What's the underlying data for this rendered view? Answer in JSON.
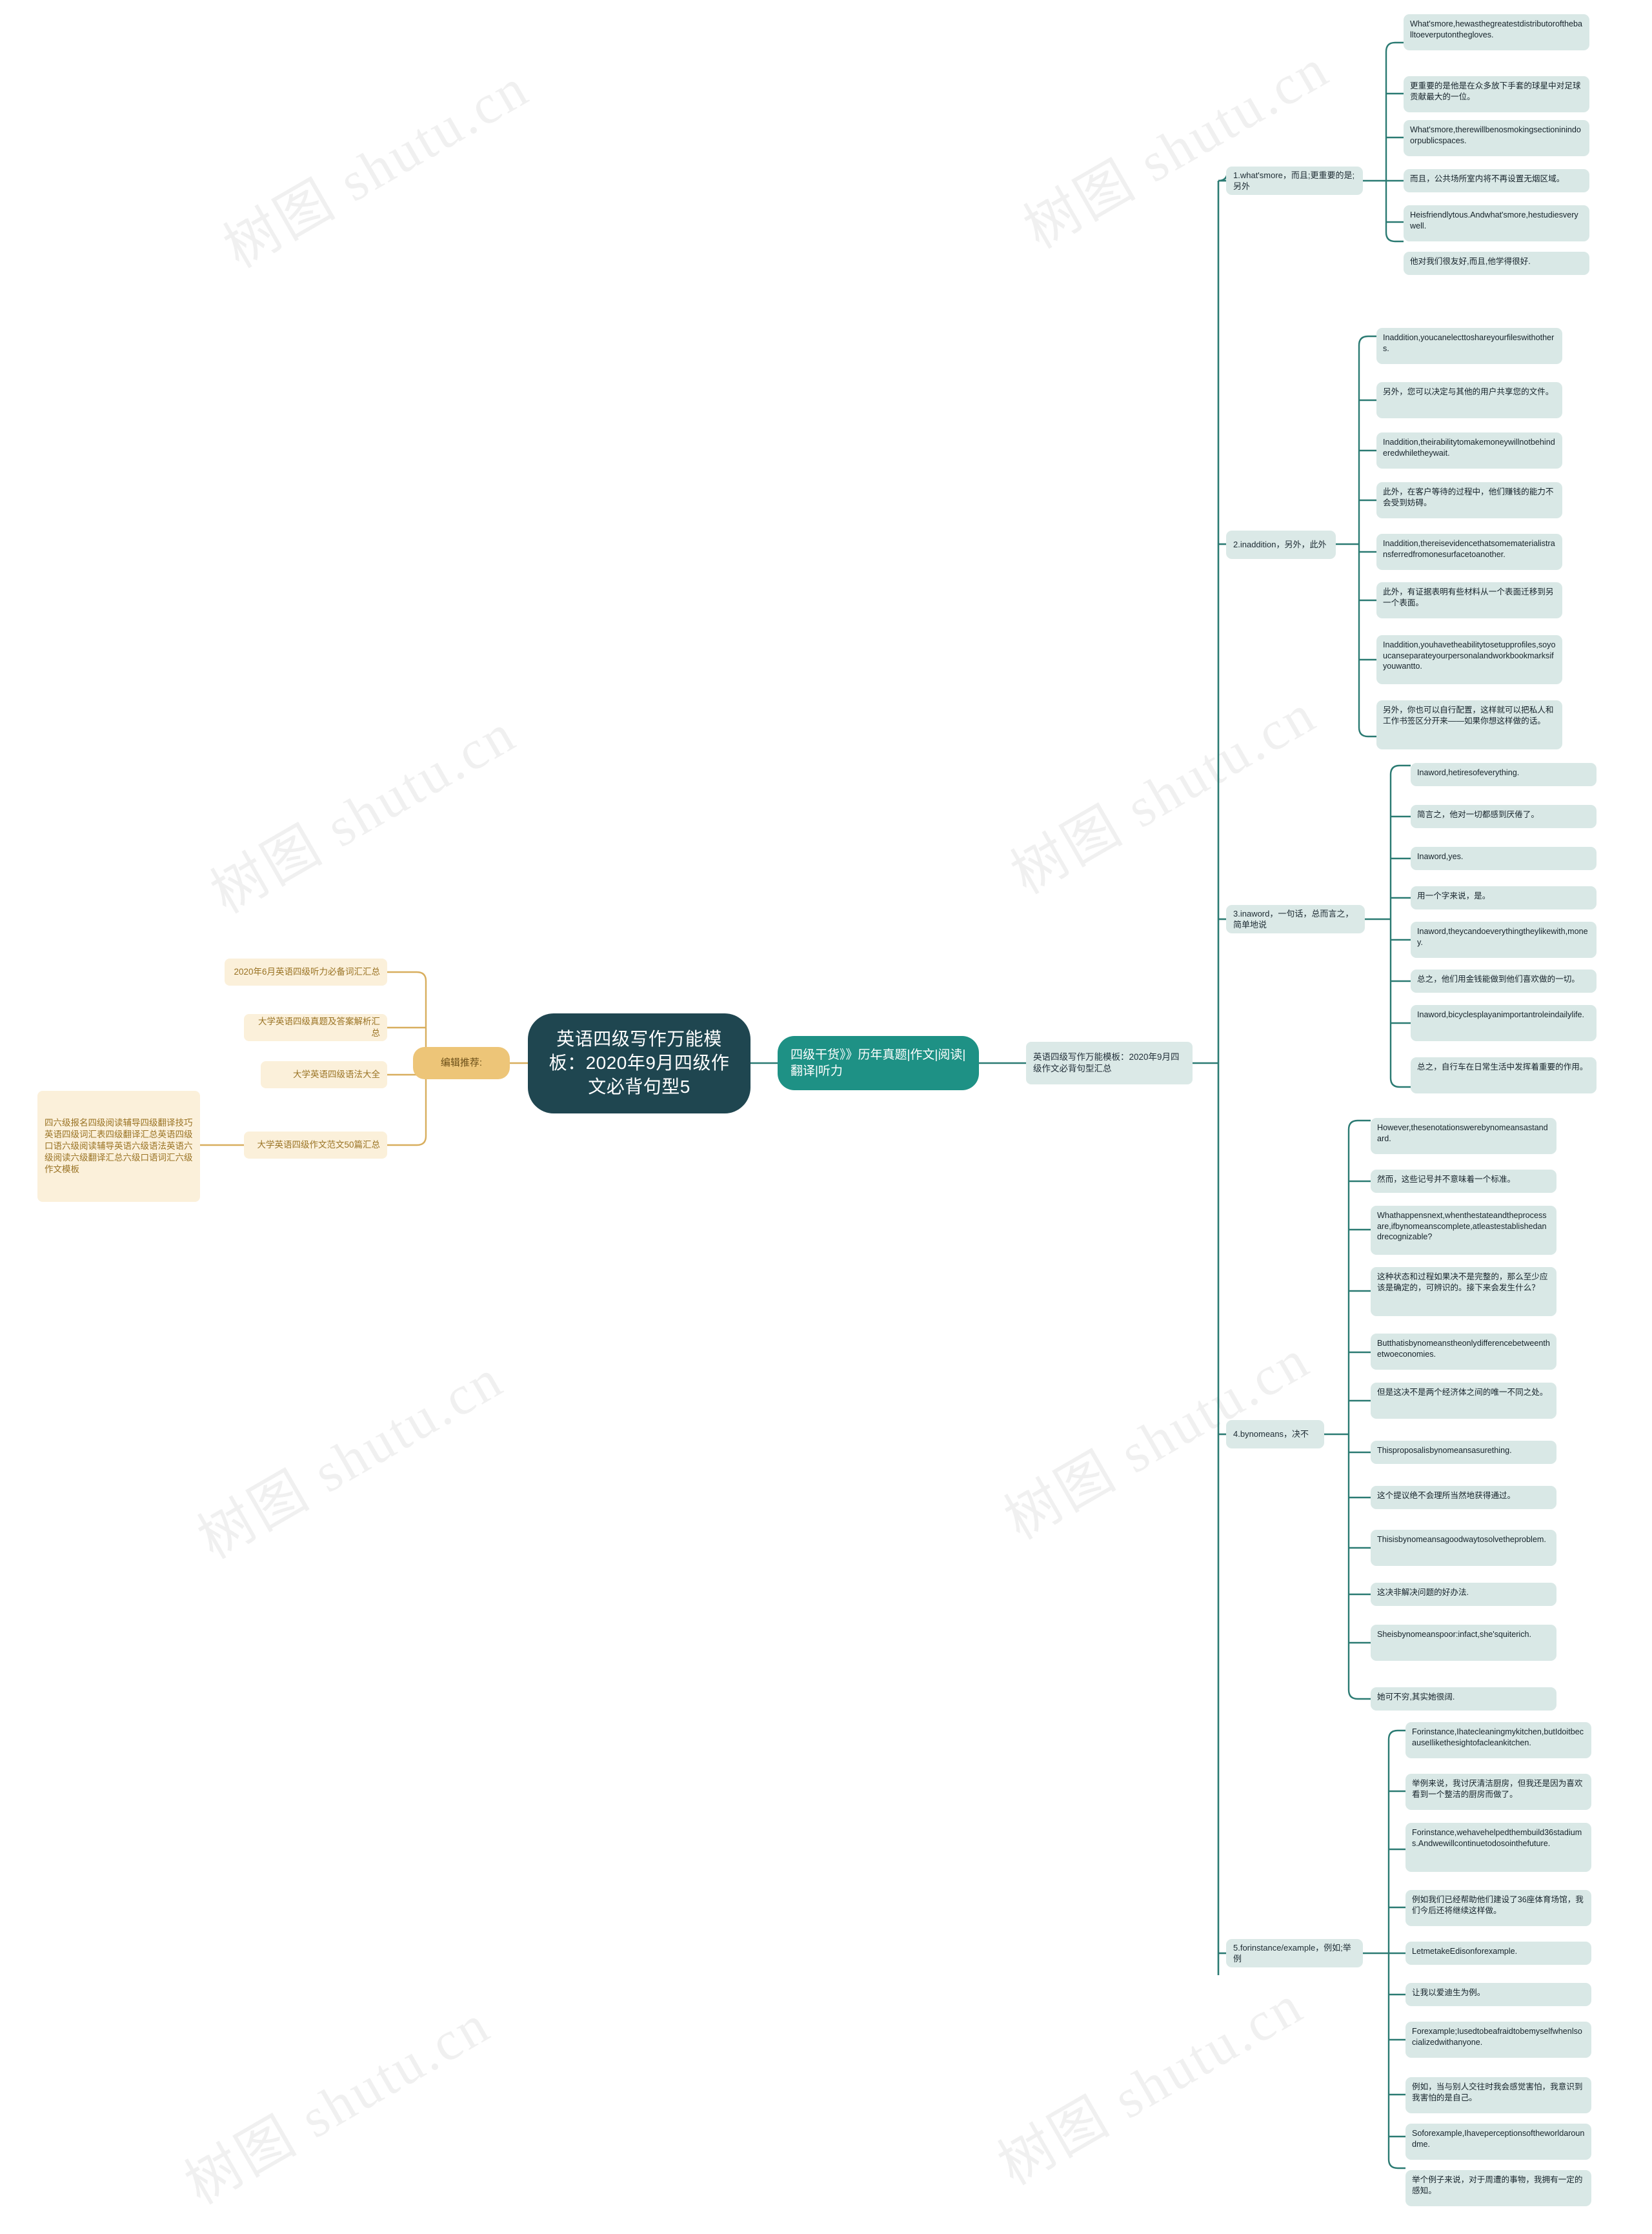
{
  "watermark": {
    "text": "树图 shutu.cn"
  },
  "colors": {
    "root_bg": "#1f4650",
    "level1_green": "#1e9185",
    "level1_gold": "#edc578",
    "leaf_bg": "#d9e8e6",
    "gold_leaf_bg": "#fbf0da",
    "link_green": "#2a7a72",
    "link_gold": "#d8ae5e"
  },
  "root": {
    "label": "英语四级写作万能模板：2020年9月四级作文必背句型5"
  },
  "left": {
    "level1": {
      "label": "编辑推荐:"
    },
    "items": [
      {
        "label": "2020年6月英语四级听力必备词汇汇总"
      },
      {
        "label": "大学英语四级真题及答案解析汇总"
      },
      {
        "label": "大学英语四级语法大全"
      },
      {
        "label": "大学英语四级作文范文50篇汇总"
      }
    ],
    "tail": {
      "label": "四六级报名四级阅读辅导四级翻译技巧英语四级词汇表四级翻译汇总英语四级口语六级阅读辅导英语六级语法英语六级阅读六级翻译汇总六级口语词汇六级作文模板"
    }
  },
  "right": {
    "level1": {
      "label": "四级干货》》历年真题|作文|阅读|翻译|听力"
    },
    "topic": {
      "label": "英语四级写作万能模板：2020年9月四级作文必背句型汇总"
    },
    "branches": [
      {
        "label": "1.what'smore，而且;更重要的是;另外",
        "leaves": [
          "What'smore,hewasthegreatestdistributoroftheballtoeverputonthegloves.",
          "更重要的是他是在众多放下手套的球星中对足球贡献最大的一位。",
          "What'smore,therewillbenosmokingsectioninindoorpublicspaces.",
          "而且，公共场所室内将不再设置无烟区域。",
          "Heisfriendlytous.Andwhat'smore,hestudiesverywell.",
          "他对我们很友好,而且,他学得很好."
        ]
      },
      {
        "label": "2.inaddition，另外，此外",
        "leaves": [
          "Inaddition,youcanelecttoshareyourfileswithothers.",
          "另外，您可以决定与其他的用户共享您的文件。",
          "Inaddition,theirabilitytomakemoneywillnotbehinderedwhiletheywait.",
          "此外，在客户等待的过程中，他们赚钱的能力不会受到妨碍。",
          "Inaddition,thereisevidencethatsomematerialistransferredfromonesurfacetoanother.",
          "此外，有证据表明有些材料从一个表面迁移到另一个表面。",
          "Inaddition,youhavetheabilitytosetupprofiles,soyoucanseparateyourpersonalandworkbookmarksifyouwantto.",
          "另外，你也可以自行配置，这样就可以把私人和工作书签区分开来——如果你想这样做的话。"
        ]
      },
      {
        "label": "3.inaword，一句话，总而言之，简单地说",
        "leaves": [
          "Inaword,hetiresofeverything.",
          "简言之，他对一切都感到厌倦了。",
          "Inaword,yes.",
          "用一个字来说，是。",
          "Inaword,theycandoeverythingtheylikewith,money.",
          "总之，他们用金钱能做到他们喜欢做的一切。",
          "Inaword,bicyclesplayanimportantroleindailylife.",
          "总之，自行车在日常生活中发挥着重要的作用。"
        ]
      },
      {
        "label": "4.bynomeans，决不",
        "leaves": [
          "However,thesenotationswerebynomeansastandard.",
          "然而，这些记号并不意味着一个标准。",
          "Whathappensnext,whenthestateandtheprocessare,ifbynomeanscomplete,atleastestablishedandrecognizable?",
          "这种状态和过程如果决不是完整的，那么至少应该是确定的，可辨识的。接下来会发生什么？",
          "Butthatisbynomeanstheonlydifferencebetweenthetwoeconomies.",
          "但是这决不是两个经济体之间的唯一不同之处。",
          "Thisproposalisbynomeansasurething.",
          "这个提议绝不会理所当然地获得通过。",
          "Thisisbynomeansagoodwaytosolvetheproblem.",
          "这决非解决问题的好办法.",
          "Sheisbynomeanspoor:infact,she'squiterich.",
          "她可不穷,其实她很阔."
        ]
      },
      {
        "label": "5.forinstance/example，例如;举例",
        "leaves": [
          "Forinstance,Ihatecleaningmykitchen,butIdoitbecauseIlikethesightofacleankitchen.",
          "举例来说，我讨厌清洁厨房，但我还是因为喜欢看到一个整洁的厨房而做了。",
          "Forinstance,wehavehelpedthembuild36stadiums.Andwewillcontinuetodosointhefuture.",
          "例如我们已经帮助他们建设了36座体育场馆，我们今后还将继续这样做。",
          "LetmetakeEdisonforexample.",
          "让我以爱迪生为例。",
          "Forexample;Iusedtobeafraidtobemyselfwhenlsocializedwithanyone.",
          "例如，当与别人交往时我会感觉害怕，我意识到我害怕的是自己。",
          "Soforexample,Ihaveperceptionsoftheworldaroundme.",
          "举个例子来说，对于周遭的事物，我拥有一定的感知。"
        ]
      }
    ]
  }
}
